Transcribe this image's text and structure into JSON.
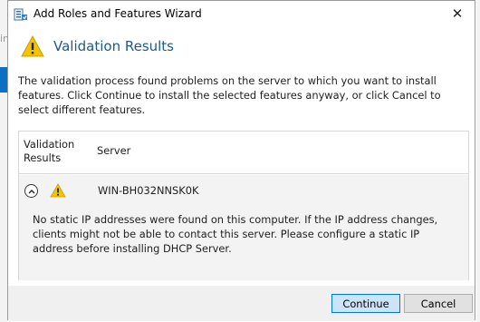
{
  "background": {
    "fragment": "in"
  },
  "window": {
    "title": "Add Roles and Features Wizard",
    "close_glyph": "✕"
  },
  "header": {
    "heading": "Validation Results",
    "icon": "warning-icon"
  },
  "description": "The validation process found problems on the server to which you want to install features. Click Continue to install the selected features anyway, or click Cancel to select different features.",
  "table": {
    "columns": [
      "Validation Results",
      "Server"
    ],
    "rows": [
      {
        "status_icon": "warning-icon",
        "server": "WIN-BH032NNSK0K",
        "message": "No static IP addresses were found on this computer. If the IP address changes, clients might not be able to contact this server. Please configure a static IP address before installing DHCP Server."
      }
    ]
  },
  "buttons": {
    "continue": "Continue",
    "cancel": "Cancel"
  },
  "colors": {
    "heading": "#1c5a8a",
    "warning": "#f3c400",
    "accent": "#0078d7"
  }
}
